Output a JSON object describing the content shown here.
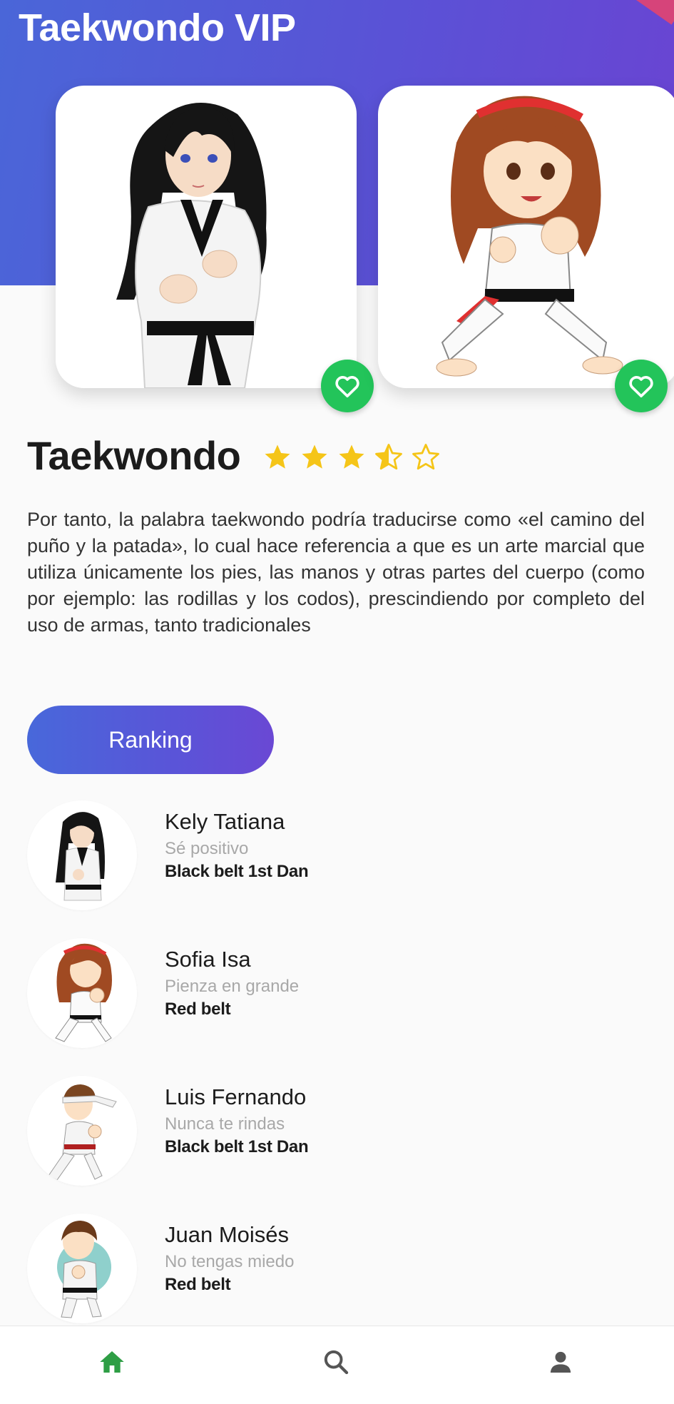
{
  "app": {
    "title": "Taekwondo VIP"
  },
  "colors": {
    "accent": "#5a56d8",
    "favorite": "#23c45a",
    "star": "#f5c518",
    "nav_active": "#2e9e45",
    "nav_inactive": "#555555"
  },
  "carousel": [
    {
      "illustration": "female-martial-artist-black-belt",
      "favorite_icon": "heart-icon"
    },
    {
      "illustration": "female-martial-artist-red-belt",
      "favorite_icon": "heart-icon"
    }
  ],
  "detail": {
    "title": "Taekwondo",
    "rating": 3.5,
    "rating_max": 5,
    "description": "Por tanto, la palabra taekwondo podría traducirse como «el camino del puño y la patada», lo cual hace referencia a que es un arte marcial que utiliza únicamente los pies, las manos y otras partes del cuerpo (como por ejemplo: las rodillas y los codos), prescindiendo por completo del uso de armas, tanto tradicionales"
  },
  "ranking_button": {
    "label": "Ranking"
  },
  "ranking": [
    {
      "name": "Kely Tatiana",
      "motto": "Sé positivo",
      "belt": "Black belt 1st Dan"
    },
    {
      "name": "Sofia Isa",
      "motto": "Pienza en grande",
      "belt": "Red belt"
    },
    {
      "name": "Luis Fernando",
      "motto": "Nunca te rindas",
      "belt": "Black belt 1st Dan"
    },
    {
      "name": "Juan Moisés",
      "motto": "No tengas miedo",
      "belt": "Red belt"
    }
  ],
  "bottom_nav": [
    {
      "icon": "home-icon",
      "active": true
    },
    {
      "icon": "search-icon",
      "active": false
    },
    {
      "icon": "profile-icon",
      "active": false
    }
  ]
}
